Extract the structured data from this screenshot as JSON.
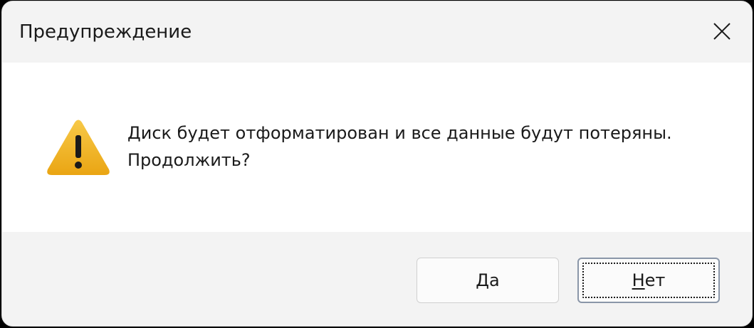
{
  "dialog": {
    "title": "Предупреждение",
    "close_icon": "close-icon",
    "warning_icon": "warning-icon",
    "message_line1": "Диск будет отформатирован и все данные будут потеряны.",
    "message_line2": "Продолжить?",
    "buttons": {
      "yes_label": "Да",
      "no_label_first": "Н",
      "no_label_rest": "ет"
    },
    "colors": {
      "warning_fill": "#F2B824",
      "titlebar_bg": "#F3F3F3",
      "content_bg": "#FFFFFF"
    }
  }
}
